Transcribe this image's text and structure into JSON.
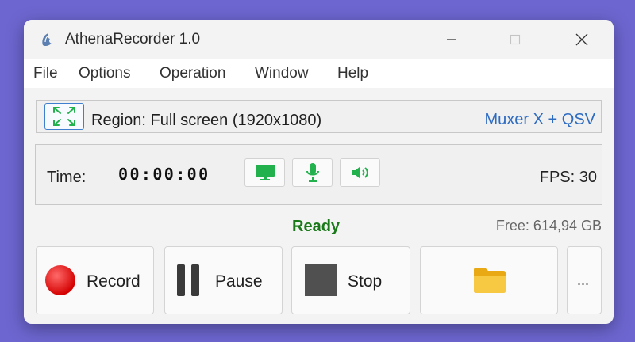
{
  "window": {
    "title": "AthenaRecorder 1.0"
  },
  "menu": [
    "File",
    "Options",
    "Operation",
    "Window",
    "Help"
  ],
  "region": {
    "text": "Region: Full screen (1920x1080)",
    "encoder": "Muxer X + QSV"
  },
  "timer": {
    "label": "Time:",
    "value": "00:00:00",
    "fps": "FPS: 30"
  },
  "sources": [
    "monitor-icon",
    "microphone-icon",
    "speaker-icon"
  ],
  "status": {
    "text": "Ready",
    "free_space": "Free: 614,94 GB"
  },
  "buttons": {
    "record": "Record",
    "pause": "Pause",
    "stop": "Stop",
    "more": "..."
  },
  "colors": {
    "accent_green": "#22b14c",
    "status_green": "#1a7a1a",
    "record_red": "#e8141c",
    "link_blue": "#2e6cc2",
    "background": "#6d66d0"
  }
}
